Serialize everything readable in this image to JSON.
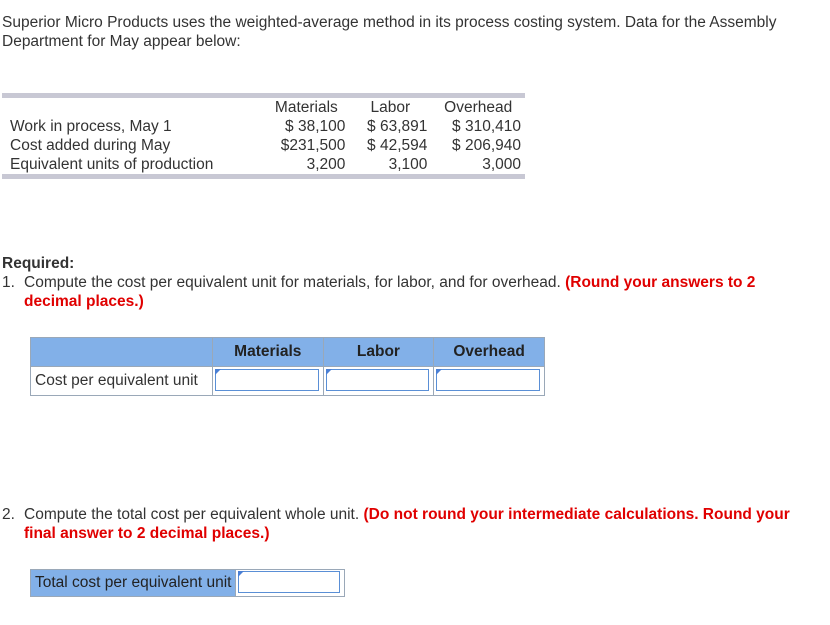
{
  "intro": {
    "text": "Superior Micro Products uses the weighted-average method in its process costing system. Data for the Assembly Department for May appear below:"
  },
  "data_table": {
    "headers": [
      "Materials",
      "Labor",
      "Overhead"
    ],
    "rows": [
      {
        "label": "Work in process, May 1",
        "materials": "$ 38,100",
        "labor": "$ 63,891",
        "overhead": "$ 310,410"
      },
      {
        "label": "Cost added during May",
        "materials": "$231,500",
        "labor": "$ 42,594",
        "overhead": "$ 206,940"
      },
      {
        "label": "Equivalent units of production",
        "materials": "3,200",
        "labor": "3,100",
        "overhead": "3,000"
      }
    ]
  },
  "required": {
    "title": "Required:",
    "q1_num": "1.",
    "q1_text": "Compute the cost per equivalent unit for materials, for labor, and for overhead.",
    "q1_note": "(Round your answers to 2 decimal places.)",
    "q2_num": "2.",
    "q2_text": "Compute the total cost per equivalent whole unit.",
    "q2_note": "(Do not round your intermediate calculations. Round your final answer to 2 decimal places.)"
  },
  "answer1": {
    "headers": [
      "Materials",
      "Labor",
      "Overhead"
    ],
    "row_label": "Cost per equivalent unit",
    "values": [
      "",
      "",
      ""
    ]
  },
  "answer2": {
    "row_label": "Total cost per equivalent unit",
    "value": ""
  },
  "colors": {
    "header_fill": "#82b0e8",
    "note_red": "#e00000",
    "band_gray": "#c8c8d4"
  }
}
